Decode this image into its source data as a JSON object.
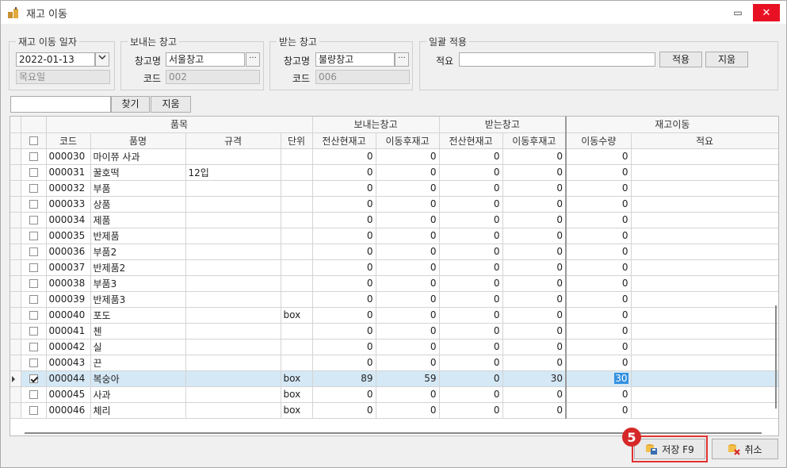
{
  "window": {
    "title": "재고 이동",
    "min_glyph": "▭",
    "close_glyph": "✕"
  },
  "date_group": {
    "legend": "재고 이동 일자",
    "date_value": "2022-01-13",
    "weekday_value": "목요일"
  },
  "send_group": {
    "legend": "보내는 창고",
    "name_label": "창고명",
    "name_value": "서울창고",
    "code_label": "코드",
    "code_value": "002",
    "browse_label": "···"
  },
  "recv_group": {
    "legend": "받는 창고",
    "name_label": "창고명",
    "name_value": "불량창고",
    "code_label": "코드",
    "code_value": "006",
    "browse_label": "···"
  },
  "bulk_group": {
    "legend": "일괄 적용",
    "memo_label": "적요",
    "memo_value": "",
    "apply_label": "적용",
    "clear_label": "지움"
  },
  "search": {
    "value": "",
    "find_label": "찾기",
    "clear_label": "지움"
  },
  "grid": {
    "group_headers": {
      "item": "품목",
      "send": "보내는창고",
      "recv": "받는창고",
      "move": "재고이동"
    },
    "columns": {
      "code": "코드",
      "name": "품명",
      "spec": "규격",
      "unit": "단위",
      "send_book": "전산현재고",
      "send_after": "이동후재고",
      "recv_book": "전산현재고",
      "recv_after": "이동후재고",
      "qty": "이동수량",
      "memo": "적요"
    },
    "rows": [
      {
        "checked": false,
        "code": "000030",
        "name": "마이쮸 사과",
        "spec": "",
        "unit": "",
        "send_book": "0",
        "send_after": "0",
        "recv_book": "0",
        "recv_after": "0",
        "qty": "0",
        "memo": ""
      },
      {
        "checked": false,
        "code": "000031",
        "name": "꿀호떡",
        "spec": "12입",
        "unit": "",
        "send_book": "0",
        "send_after": "0",
        "recv_book": "0",
        "recv_after": "0",
        "qty": "0",
        "memo": ""
      },
      {
        "checked": false,
        "code": "000032",
        "name": "부품",
        "spec": "",
        "unit": "",
        "send_book": "0",
        "send_after": "0",
        "recv_book": "0",
        "recv_after": "0",
        "qty": "0",
        "memo": ""
      },
      {
        "checked": false,
        "code": "000033",
        "name": "상품",
        "spec": "",
        "unit": "",
        "send_book": "0",
        "send_after": "0",
        "recv_book": "0",
        "recv_after": "0",
        "qty": "0",
        "memo": ""
      },
      {
        "checked": false,
        "code": "000034",
        "name": "제품",
        "spec": "",
        "unit": "",
        "send_book": "0",
        "send_after": "0",
        "recv_book": "0",
        "recv_after": "0",
        "qty": "0",
        "memo": ""
      },
      {
        "checked": false,
        "code": "000035",
        "name": "반제품",
        "spec": "",
        "unit": "",
        "send_book": "0",
        "send_after": "0",
        "recv_book": "0",
        "recv_after": "0",
        "qty": "0",
        "memo": ""
      },
      {
        "checked": false,
        "code": "000036",
        "name": "부품2",
        "spec": "",
        "unit": "",
        "send_book": "0",
        "send_after": "0",
        "recv_book": "0",
        "recv_after": "0",
        "qty": "0",
        "memo": ""
      },
      {
        "checked": false,
        "code": "000037",
        "name": "반제품2",
        "spec": "",
        "unit": "",
        "send_book": "0",
        "send_after": "0",
        "recv_book": "0",
        "recv_after": "0",
        "qty": "0",
        "memo": ""
      },
      {
        "checked": false,
        "code": "000038",
        "name": "부품3",
        "spec": "",
        "unit": "",
        "send_book": "0",
        "send_after": "0",
        "recv_book": "0",
        "recv_after": "0",
        "qty": "0",
        "memo": ""
      },
      {
        "checked": false,
        "code": "000039",
        "name": "반제품3",
        "spec": "",
        "unit": "",
        "send_book": "0",
        "send_after": "0",
        "recv_book": "0",
        "recv_after": "0",
        "qty": "0",
        "memo": ""
      },
      {
        "checked": false,
        "code": "000040",
        "name": "포도",
        "spec": "",
        "unit": "box",
        "send_book": "0",
        "send_after": "0",
        "recv_book": "0",
        "recv_after": "0",
        "qty": "0",
        "memo": ""
      },
      {
        "checked": false,
        "code": "000041",
        "name": "첸",
        "spec": "",
        "unit": "",
        "send_book": "0",
        "send_after": "0",
        "recv_book": "0",
        "recv_after": "0",
        "qty": "0",
        "memo": ""
      },
      {
        "checked": false,
        "code": "000042",
        "name": "실",
        "spec": "",
        "unit": "",
        "send_book": "0",
        "send_after": "0",
        "recv_book": "0",
        "recv_after": "0",
        "qty": "0",
        "memo": ""
      },
      {
        "checked": false,
        "code": "000043",
        "name": "끈",
        "spec": "",
        "unit": "",
        "send_book": "0",
        "send_after": "0",
        "recv_book": "0",
        "recv_after": "0",
        "qty": "0",
        "memo": ""
      },
      {
        "checked": true,
        "selected": true,
        "code": "000044",
        "name": "복숭아",
        "spec": "",
        "unit": "box",
        "send_book": "89",
        "send_after": "59",
        "recv_book": "0",
        "recv_after": "30",
        "qty": "30",
        "memo": ""
      },
      {
        "checked": false,
        "code": "000045",
        "name": "사과",
        "spec": "",
        "unit": "box",
        "send_book": "0",
        "send_after": "0",
        "recv_book": "0",
        "recv_after": "0",
        "qty": "0",
        "memo": ""
      },
      {
        "checked": false,
        "code": "000046",
        "name": "체리",
        "spec": "",
        "unit": "box",
        "send_book": "0",
        "send_after": "0",
        "recv_book": "0",
        "recv_after": "0",
        "qty": "0",
        "memo": ""
      }
    ]
  },
  "footer": {
    "badge": "5",
    "save_label": "저장 F9",
    "cancel_label": "취소"
  },
  "colors": {
    "close": "#e81123",
    "selected_row": "#d5e8f5",
    "highlight": "#e03131",
    "badge": "#d62828"
  }
}
